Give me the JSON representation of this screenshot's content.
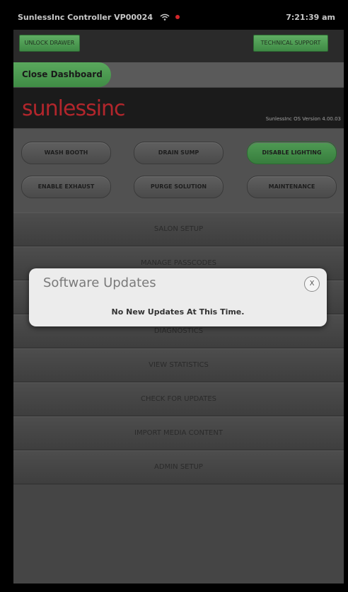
{
  "status_bar": {
    "title": "SunlessInc Controller  VP00024",
    "time": "7:21:39 am"
  },
  "header": {
    "unlock_drawer": "UNLOCK DRAWER",
    "technical_support": "TECHNICAL SUPPORT",
    "close_dashboard": "Close Dashboard"
  },
  "brand": {
    "logo": "sunlessinc",
    "os_version": "SunlessInc OS Version 4.00.03",
    "logo_color": "#b2262c"
  },
  "controls": {
    "wash_booth": "WASH BOOTH",
    "drain_sump": "DRAIN SUMP",
    "disable_lighting": "DISABLE LIGHTING",
    "enable_exhaust": "ENABLE EXHAUST",
    "purge_solution": "PURGE SOLUTION",
    "maintenance": "MAINTENANCE"
  },
  "menu": {
    "salon_setup": "SALON SETUP",
    "manage_passcodes": "MANAGE PASSCODES",
    "hidden_item": "",
    "diagnostics": "DIAGNOSTICS",
    "view_statistics": "VIEW STATISTICS",
    "check_updates": "CHECK FOR UPDATES",
    "import_media": "IMPORT MEDIA CONTENT",
    "admin_setup": "ADMIN SETUP"
  },
  "modal": {
    "title": "Software Updates",
    "message": "No New Updates At This Time.",
    "close_label": "X"
  },
  "colors": {
    "accent_green": "#4f9a54",
    "alert_red": "#d3262a"
  }
}
